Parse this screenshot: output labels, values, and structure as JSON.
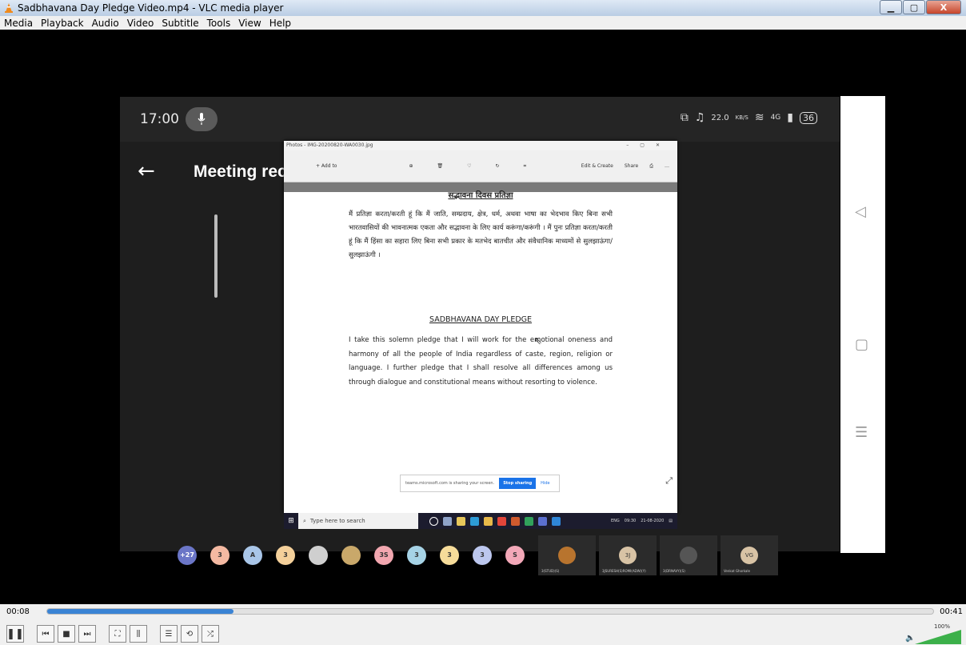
{
  "window": {
    "title": "Sadbhavana Day Pledge Video.mp4 - VLC media player",
    "minimize_icon": "minimize-icon",
    "maximize_icon": "maximize-icon",
    "close_label": "X"
  },
  "menu": [
    "Media",
    "Playback",
    "Audio",
    "Video",
    "Subtitle",
    "Tools",
    "View",
    "Help"
  ],
  "phone": {
    "clock": "17:00",
    "speed_value": "22.0",
    "speed_unit": "KB/S",
    "network": "4G",
    "battery": "36",
    "meeting_title": "Meeting recording"
  },
  "photos": {
    "window_title": "Photos - IMG-20200820-WA0030.jpg",
    "add_to": "+ Add to",
    "edit_create": "Edit & Create",
    "share": "Share"
  },
  "document": {
    "hindi_heading": "सद्भावना दिवस प्रतिज्ञा",
    "hindi_text": "मैं प्रतिज्ञा करता/करती हूं कि मैं जाति, सम्प्रदाय, क्षेत्र, धर्म, अथवा भाषा का भेदभाव किए बिना सभी भारतवासियों की भावनात्मक एकता और सद्भावना के लिए कार्य करूंगा/करूंगी । मैं पुनः प्रतिज्ञा करता/करती हूं कि मैं हिंसा का सहारा लिए बिना सभी प्रकार के मतभेद बातचीत और संवैधानिक माध्यमों से सुलझाऊंगा/ सुलझाऊंगी ।",
    "english_heading": "SADBHAVANA DAY PLEDGE",
    "english_text": "I take this solemn pledge that I will work for the emotional oneness and harmony of all the people of India regardless of caste, region, religion or language. I further pledge that I shall resolve all differences among us through dialogue and constitutional means without resorting to violence."
  },
  "share_notice": {
    "text": "teams.microsoft.com is sharing your screen.",
    "stop": "Stop sharing",
    "hide": "Hide"
  },
  "taskbar": {
    "search": "Type here to search",
    "lang": "ENG",
    "time": "09:30",
    "date": "21-08-2020"
  },
  "participants": {
    "avatars": [
      {
        "label": "+27",
        "color": "#6b76c7"
      },
      {
        "label": "3",
        "color": "#f4b9a2"
      },
      {
        "label": "A",
        "color": "#a9c6e8"
      },
      {
        "label": "3",
        "color": "#f4d09a"
      },
      {
        "label": "",
        "color": "#cfcfcf"
      },
      {
        "label": "",
        "color": "#c9a86a"
      },
      {
        "label": "3S",
        "color": "#f2a7b0"
      },
      {
        "label": "3",
        "color": "#a6d3e6"
      },
      {
        "label": "3",
        "color": "#f6dc9a"
      },
      {
        "label": "3",
        "color": "#bcc7ee"
      },
      {
        "label": "S",
        "color": "#f3a8b8"
      }
    ],
    "tiles": [
      {
        "initials": "",
        "name": "3(STUD)(S)"
      },
      {
        "initials": "3J",
        "name": "3JSURESH(S)ROMI(ADW)(Y)"
      },
      {
        "initials": "",
        "name": "3(DRNAVY)(S)"
      },
      {
        "initials": "VG",
        "name": "Venkat Ghorkale"
      }
    ]
  },
  "player": {
    "elapsed": "00:08",
    "total": "00:41",
    "progress_fraction": 0.21,
    "volume": "100%"
  }
}
